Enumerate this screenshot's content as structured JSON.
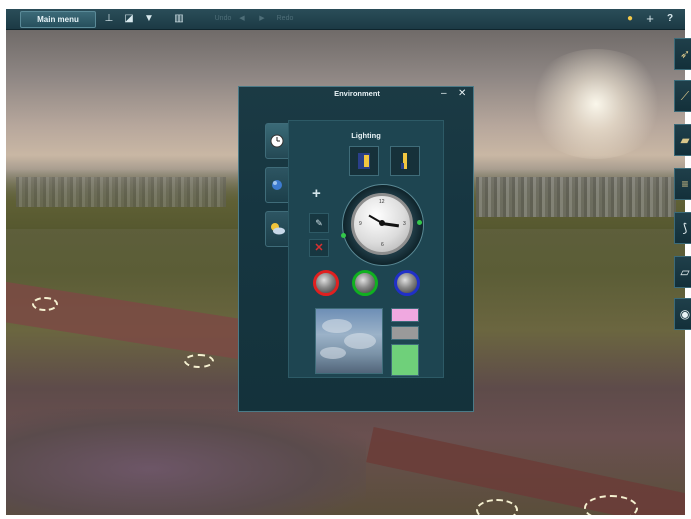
{
  "toolbar": {
    "main_menu_label": "Main menu",
    "undo_label": "Undo",
    "redo_label": "Redo"
  },
  "dialog": {
    "title": "Environment",
    "minimize_glyph": "–",
    "close_glyph": "✕",
    "section_label": "Lighting",
    "tabs": [
      {
        "icon": "clock-icon",
        "active": true
      },
      {
        "icon": "weather-icon",
        "active": false
      },
      {
        "icon": "sky-icon",
        "active": false
      }
    ],
    "clock_numbers": [
      "12",
      "3",
      "6",
      "9"
    ],
    "dial_colors": [
      "#e02020",
      "#10b020",
      "#2030c8"
    ],
    "swatches": [
      {
        "color": "#f0a8e0"
      },
      {
        "color": "#9a9a9a"
      },
      {
        "color": "#6fd07a"
      }
    ]
  },
  "colors": {
    "toolbar_bg": "#1f4450",
    "dialog_bg": "#163641",
    "accent_text": "#e8f2f5"
  },
  "side_icons": [
    "train-icon",
    "track-icon",
    "wagon-icon",
    "ladder-icon",
    "wrench-icon",
    "layer-icon",
    "target-icon"
  ]
}
